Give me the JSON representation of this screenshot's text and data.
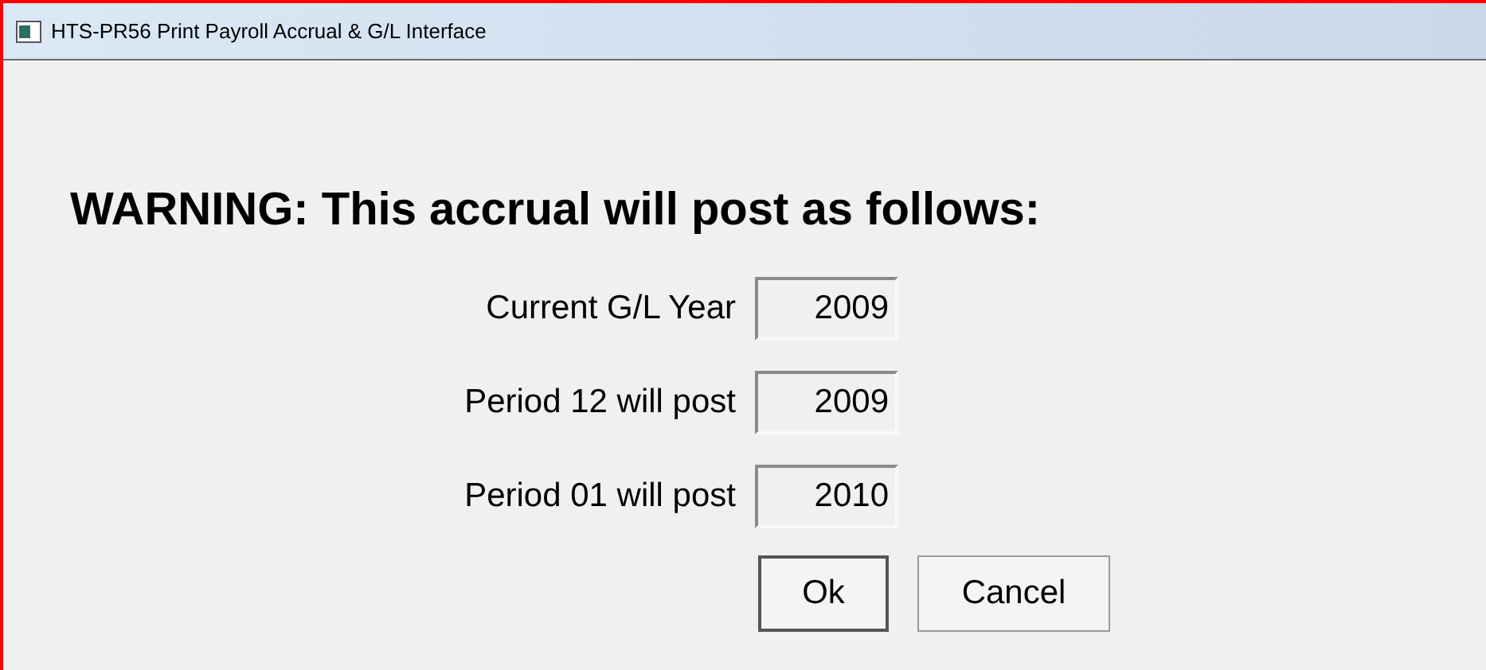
{
  "window": {
    "title": "HTS-PR56 Print Payroll Accrual & G/L Interface"
  },
  "heading": "WARNING: This accrual will post as follows:",
  "fields": [
    {
      "label": "Current G/L Year",
      "value": "2009"
    },
    {
      "label": "Period 12 will post",
      "value": "2009"
    },
    {
      "label": "Period 01 will post",
      "value": "2010"
    }
  ],
  "buttons": [
    {
      "label": "Ok",
      "default": true
    },
    {
      "label": "Cancel",
      "default": false
    }
  ]
}
